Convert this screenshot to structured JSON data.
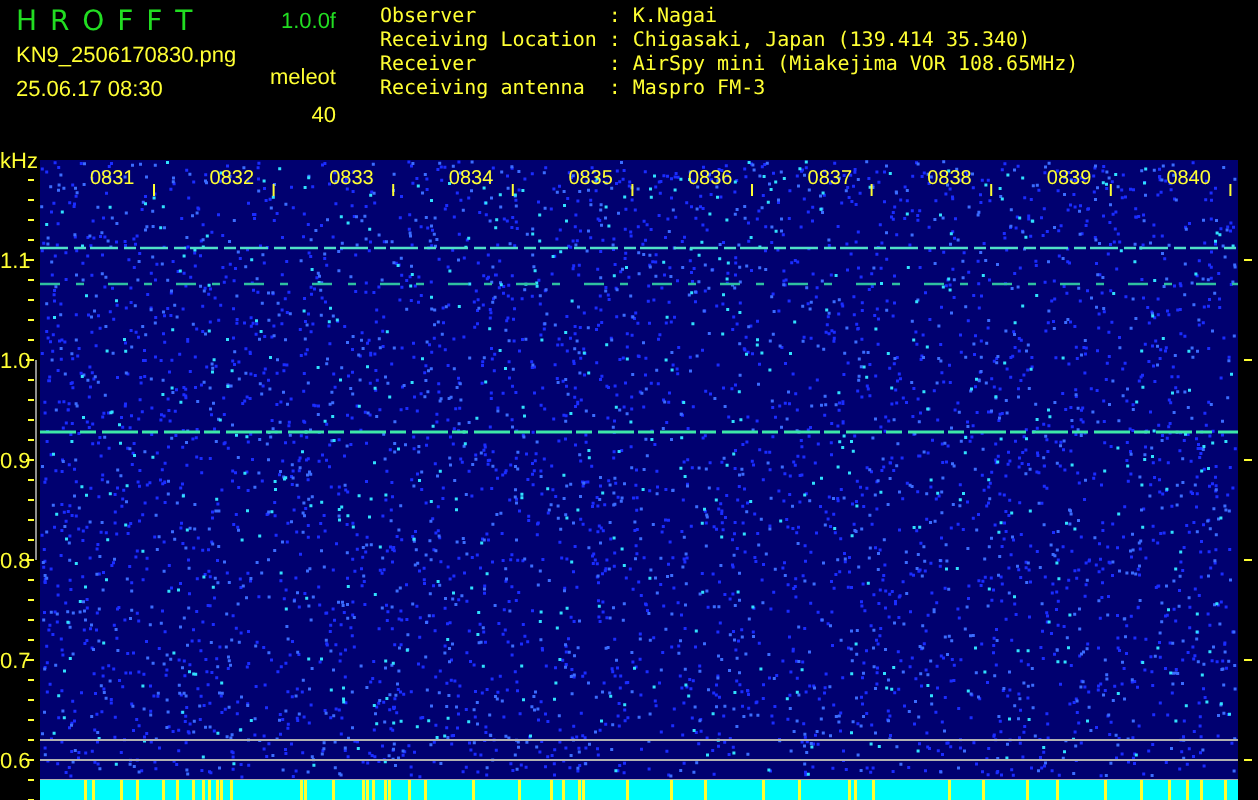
{
  "header": {
    "title": "H R O F F T",
    "version": "1.0.0f",
    "file_name": "KN9_2506170830.png",
    "date_time": "25.06.17 08:30",
    "mode": "meleot",
    "count": "40"
  },
  "info": [
    {
      "label": "Observer",
      "separator": ":",
      "value": "K.Nagai"
    },
    {
      "label": "Receiving Location",
      "separator": ":",
      "value": "Chigasaki, Japan (139.414 35.340)"
    },
    {
      "label": "Receiver",
      "separator": ":",
      "value": "AirSpy mini (Miakejima VOR 108.65MHz)"
    },
    {
      "label": "Receiving antenna",
      "separator": ":",
      "value": "Maspro FM-3"
    }
  ],
  "spectrogram": {
    "unit": "kHz",
    "y_labels": [
      "1.1",
      "1.0",
      "0.9",
      "0.8",
      "0.7",
      "0.6"
    ],
    "time_labels": [
      "0831",
      "0832",
      "0833",
      "0834",
      "0835",
      "0836",
      "0837",
      "0838",
      "0839",
      "0840"
    ]
  }
}
